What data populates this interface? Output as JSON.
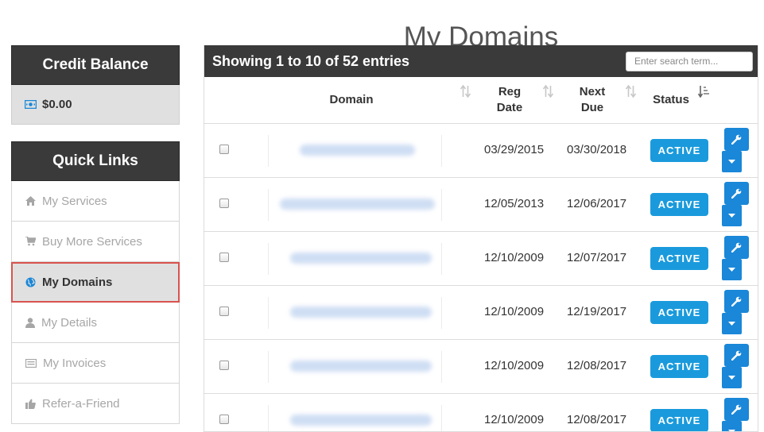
{
  "page": {
    "title": "My Domains"
  },
  "sidebar": {
    "credit": {
      "title": "Credit Balance",
      "amount": "$0.00",
      "icon": "money-icon"
    },
    "quick_links": {
      "title": "Quick Links",
      "items": [
        {
          "label": "My Services",
          "icon": "home-icon"
        },
        {
          "label": "Buy More Services",
          "icon": "cart-icon"
        },
        {
          "label": "My Domains",
          "icon": "globe-icon",
          "active": true
        },
        {
          "label": "My Details",
          "icon": "user-icon"
        },
        {
          "label": "My Invoices",
          "icon": "invoice-icon"
        },
        {
          "label": "Refer-a-Friend",
          "icon": "thumbs-up-icon"
        }
      ]
    }
  },
  "table": {
    "entries_text": "Showing 1 to 10 of 52 entries",
    "search_placeholder": "Enter search term...",
    "headers": {
      "domain": "Domain",
      "reg_date_1": "Reg",
      "reg_date_2": "Date",
      "next_due_1": "Next",
      "next_due_2": "Due",
      "status": "Status"
    },
    "rows": [
      {
        "reg_date": "03/29/2015",
        "next_due": "03/30/2018",
        "status": "ACTIVE"
      },
      {
        "reg_date": "12/05/2013",
        "next_due": "12/06/2017",
        "status": "ACTIVE"
      },
      {
        "reg_date": "12/10/2009",
        "next_due": "12/07/2017",
        "status": "ACTIVE"
      },
      {
        "reg_date": "12/10/2009",
        "next_due": "12/19/2017",
        "status": "ACTIVE"
      },
      {
        "reg_date": "12/10/2009",
        "next_due": "12/08/2017",
        "status": "ACTIVE"
      },
      {
        "reg_date": "12/10/2009",
        "next_due": "12/08/2017",
        "status": "ACTIVE"
      }
    ]
  },
  "colors": {
    "header_dark": "#3a3a3a",
    "accent_blue": "#1a9adc",
    "active_outline": "#d9534f"
  }
}
